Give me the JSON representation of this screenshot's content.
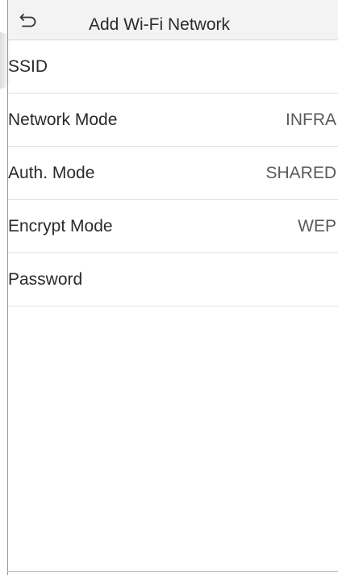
{
  "header": {
    "back_icon": "back-arrow-icon",
    "title": "Add Wi-Fi Network"
  },
  "rows": [
    {
      "label": "SSID",
      "value": ""
    },
    {
      "label": "Network Mode",
      "value": "INFRA"
    },
    {
      "label": "Auth. Mode",
      "value": "SHARED"
    },
    {
      "label": "Encrypt Mode",
      "value": "WEP"
    },
    {
      "label": "Password",
      "value": ""
    }
  ],
  "colors": {
    "header_bg": "#f3f3f3",
    "divider": "#e2e2e2",
    "text": "#2a2a2a",
    "value_text": "#5a5a5a"
  }
}
